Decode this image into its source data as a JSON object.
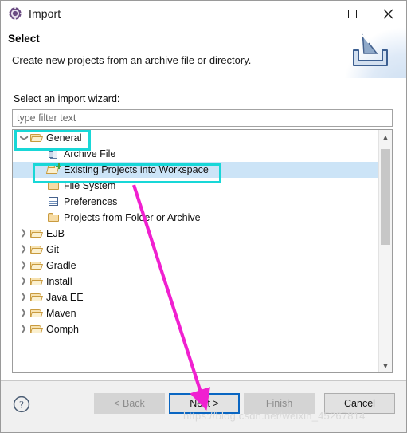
{
  "window": {
    "title": "Import",
    "icon": "eclipse-import-gear-icon",
    "controls": {
      "minimize": "minimize-icon",
      "maximize": "maximize-icon",
      "close": "close-icon"
    }
  },
  "header": {
    "title": "Select",
    "description": "Create new projects from an archive file or directory.",
    "banner_icon": "import-tray-arrow-icon"
  },
  "body": {
    "select_label": "Select an import wizard:",
    "filter": {
      "value": "",
      "placeholder": "type filter text"
    },
    "tree": [
      {
        "label": "General",
        "icon": "folder-open-icon",
        "twisty": "expanded",
        "indent": 0,
        "selected": false
      },
      {
        "label": "Archive File",
        "icon": "archive-file-icon",
        "twisty": "none",
        "indent": 1,
        "selected": false
      },
      {
        "label": "Existing Projects into Workspace",
        "icon": "existing-projects-icon",
        "twisty": "none",
        "indent": 1,
        "selected": true
      },
      {
        "label": "File System",
        "icon": "folder-icon",
        "twisty": "none",
        "indent": 1,
        "selected": false
      },
      {
        "label": "Preferences",
        "icon": "preferences-icon",
        "twisty": "none",
        "indent": 1,
        "selected": false
      },
      {
        "label": "Projects from Folder or Archive",
        "icon": "folder-icon",
        "twisty": "none",
        "indent": 1,
        "selected": false
      },
      {
        "label": "EJB",
        "icon": "folder-open-icon",
        "twisty": "collapsed",
        "indent": 0,
        "selected": false
      },
      {
        "label": "Git",
        "icon": "folder-open-icon",
        "twisty": "collapsed",
        "indent": 0,
        "selected": false
      },
      {
        "label": "Gradle",
        "icon": "folder-open-icon",
        "twisty": "collapsed",
        "indent": 0,
        "selected": false
      },
      {
        "label": "Install",
        "icon": "folder-open-icon",
        "twisty": "collapsed",
        "indent": 0,
        "selected": false
      },
      {
        "label": "Java EE",
        "icon": "folder-open-icon",
        "twisty": "collapsed",
        "indent": 0,
        "selected": false
      },
      {
        "label": "Maven",
        "icon": "folder-open-icon",
        "twisty": "collapsed",
        "indent": 0,
        "selected": false
      },
      {
        "label": "Oomph",
        "icon": "folder-open-icon",
        "twisty": "collapsed",
        "indent": 0,
        "selected": false
      }
    ],
    "scrollbar": {
      "up_arrow": "chevron-up-icon",
      "down_arrow": "chevron-down-icon"
    }
  },
  "footer": {
    "help_icon": "help-question-icon",
    "buttons": {
      "back": {
        "label": "< Back",
        "enabled": false
      },
      "next": {
        "label": "Next >",
        "enabled": true,
        "focused": true
      },
      "finish": {
        "label": "Finish",
        "enabled": false
      },
      "cancel": {
        "label": "Cancel",
        "enabled": true
      }
    }
  },
  "annotations": {
    "highlight_general": "General",
    "highlight_existing": "Existing Projects into Workspace",
    "arrow_color": "#f020d0",
    "highlight_color": "#18d7d7",
    "watermark": "https://blog.csdn.net/weixin_45267814"
  }
}
